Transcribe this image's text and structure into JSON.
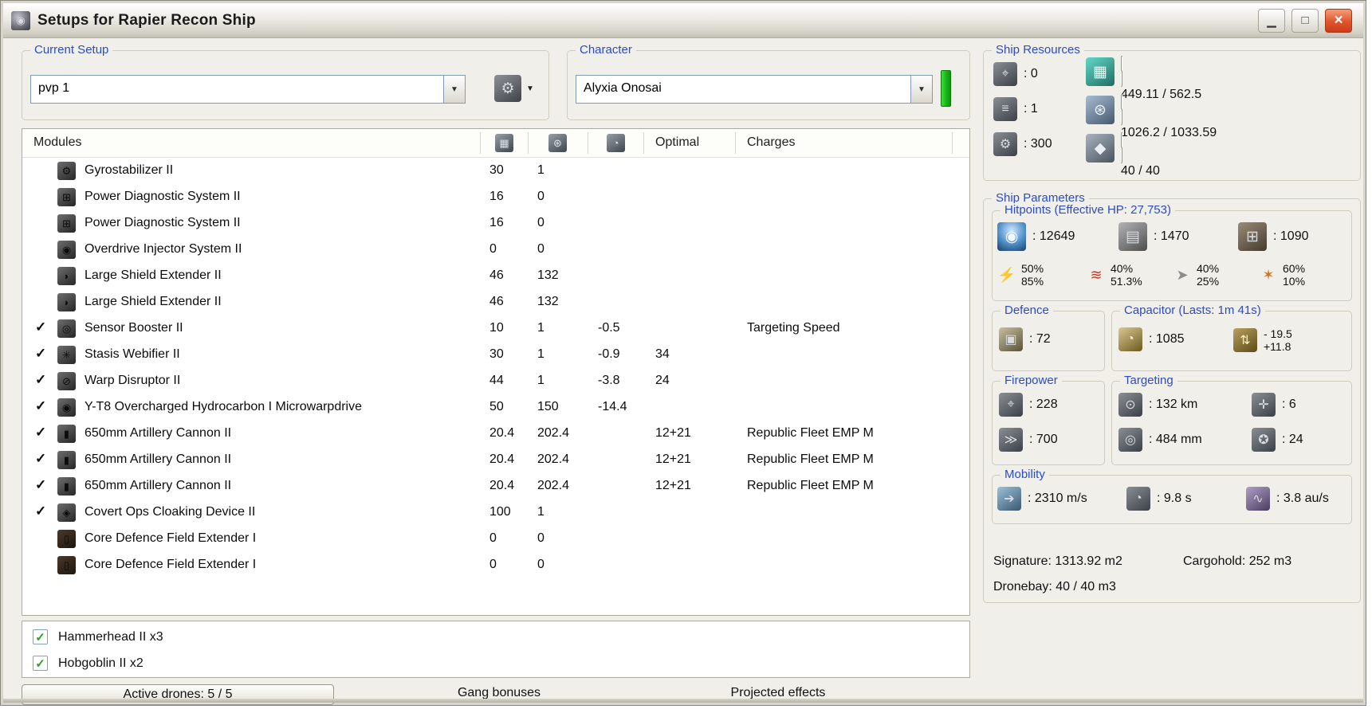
{
  "window": {
    "title": "Setups for Rapier Recon Ship"
  },
  "current_setup": {
    "label": "Current Setup",
    "value": "pvp 1"
  },
  "character": {
    "label": "Character",
    "value": "Alyxia Onosai"
  },
  "ship_resources": {
    "label": "Ship Resources",
    "turrets": ": 0",
    "launchers": ": 1",
    "calibration": ": 300",
    "cpu": "449.11 / 562.5",
    "powergrid": "1026.2 / 1033.59",
    "drones": "40 / 40",
    "cpu_fill_pct": 80,
    "powergrid_fill_pct": 99,
    "drones_fill_pct": 100
  },
  "modules_table": {
    "header": {
      "modules": "Modules",
      "optimal": "Optimal",
      "charges": "Charges"
    },
    "rows": [
      {
        "active": false,
        "icon": "gyrostabilizer-icon",
        "name": "Gyrostabilizer II",
        "cpu": "30",
        "pg": "1",
        "cap": "",
        "optimal": "",
        "charges": ""
      },
      {
        "active": false,
        "icon": "power-diagnostic-icon",
        "name": "Power Diagnostic System II",
        "cpu": "16",
        "pg": "0",
        "cap": "",
        "optimal": "",
        "charges": ""
      },
      {
        "active": false,
        "icon": "power-diagnostic-icon",
        "name": "Power Diagnostic System II",
        "cpu": "16",
        "pg": "0",
        "cap": "",
        "optimal": "",
        "charges": ""
      },
      {
        "active": false,
        "icon": "overdrive-icon",
        "name": "Overdrive Injector System II",
        "cpu": "0",
        "pg": "0",
        "cap": "",
        "optimal": "",
        "charges": ""
      },
      {
        "active": false,
        "icon": "shield-extender-icon",
        "name": "Large Shield Extender II",
        "cpu": "46",
        "pg": "132",
        "cap": "",
        "optimal": "",
        "charges": ""
      },
      {
        "active": false,
        "icon": "shield-extender-icon",
        "name": "Large Shield Extender II",
        "cpu": "46",
        "pg": "132",
        "cap": "",
        "optimal": "",
        "charges": ""
      },
      {
        "active": true,
        "icon": "sensor-booster-icon",
        "name": "Sensor Booster II",
        "cpu": "10",
        "pg": "1",
        "cap": "-0.5",
        "optimal": "",
        "charges": "Targeting Speed"
      },
      {
        "active": true,
        "icon": "stasis-webifier-icon",
        "name": "Stasis Webifier II",
        "cpu": "30",
        "pg": "1",
        "cap": "-0.9",
        "optimal": "34",
        "charges": ""
      },
      {
        "active": true,
        "icon": "warp-disruptor-icon",
        "name": "Warp Disruptor II",
        "cpu": "44",
        "pg": "1",
        "cap": "-3.8",
        "optimal": "24",
        "charges": ""
      },
      {
        "active": true,
        "icon": "microwarpdrive-icon",
        "name": "Y-T8 Overcharged Hydrocarbon I Microwarpdrive",
        "cpu": "50",
        "pg": "150",
        "cap": "-14.4",
        "optimal": "",
        "charges": ""
      },
      {
        "active": true,
        "icon": "artillery-icon",
        "name": "650mm Artillery Cannon II",
        "cpu": "20.4",
        "pg": "202.4",
        "cap": "",
        "optimal": "12+21",
        "charges": "Republic Fleet EMP M"
      },
      {
        "active": true,
        "icon": "artillery-icon",
        "name": "650mm Artillery Cannon II",
        "cpu": "20.4",
        "pg": "202.4",
        "cap": "",
        "optimal": "12+21",
        "charges": "Republic Fleet EMP M"
      },
      {
        "active": true,
        "icon": "artillery-icon",
        "name": "650mm Artillery Cannon II",
        "cpu": "20.4",
        "pg": "202.4",
        "cap": "",
        "optimal": "12+21",
        "charges": "Republic Fleet EMP M"
      },
      {
        "active": true,
        "icon": "cloak-icon",
        "name": "Covert Ops Cloaking Device II",
        "cpu": "100",
        "pg": "1",
        "cap": "",
        "optimal": "",
        "charges": ""
      },
      {
        "active": false,
        "icon": "rig-icon",
        "name": "Core Defence Field Extender I",
        "cpu": "0",
        "pg": "0",
        "cap": "",
        "optimal": "",
        "charges": ""
      },
      {
        "active": false,
        "icon": "rig-icon",
        "name": "Core Defence Field Extender I",
        "cpu": "0",
        "pg": "0",
        "cap": "",
        "optimal": "",
        "charges": ""
      }
    ]
  },
  "drones": {
    "items": [
      {
        "checked": true,
        "label": "Hammerhead II x3"
      },
      {
        "checked": true,
        "label": "Hobgoblin II x2"
      }
    ]
  },
  "footer": {
    "active_drones": "Active drones: 5 / 5",
    "gang_bonuses": "Gang bonuses",
    "projected_effects": "Projected effects"
  },
  "ship_parameters": {
    "label": "Ship Parameters",
    "hitpoints": {
      "label": "Hitpoints (Effective HP: 27,753)",
      "shield": ": 12649",
      "armor": ": 1470",
      "structure": ": 1090",
      "resists": [
        {
          "type": "em",
          "top": "50%",
          "bottom": "85%"
        },
        {
          "type": "thermal",
          "top": "40%",
          "bottom": "51.3%"
        },
        {
          "type": "kinetic",
          "top": "40%",
          "bottom": "25%"
        },
        {
          "type": "explosive",
          "top": "60%",
          "bottom": "10%"
        }
      ]
    },
    "defence": {
      "label": "Defence",
      "value": ": 72"
    },
    "capacitor": {
      "label": "Capacitor (Lasts: 1m 41s)",
      "amount": ": 1085",
      "drain": "- 19.5",
      "recharge": "+11.8"
    },
    "firepower": {
      "label": "Firepower",
      "dps": ": 228",
      "volley": ": 700"
    },
    "targeting": {
      "label": "Targeting",
      "range": ": 132 km",
      "max_targets": ": 6",
      "scan_resolution": ": 484 mm",
      "sensor_strength": ": 24"
    },
    "mobility": {
      "label": "Mobility",
      "speed": ": 2310 m/s",
      "align_time": ": 9.8 s",
      "warp_speed": ": 3.8 au/s"
    },
    "signature": "Signature: 1313.92 m2",
    "cargohold": "Cargohold: 252 m3",
    "dronebay": "Dronebay: 40 / 40 m3"
  },
  "accent_colors": {
    "group_label_blue": "#2c4cc4",
    "active_check_green": "#2fae2f",
    "resource_bar_green": "#34c034",
    "close_button_red": "#d84a22"
  },
  "icons": {
    "window-icon": "◉",
    "minimize-icon": "▁",
    "maximize-icon": "□",
    "close-icon": "×",
    "dropdown-icon": "▼",
    "setup-tool-icon": "⚙",
    "check-icon": "✓",
    "turret-icon": "⌖",
    "launcher-icon": "≡",
    "calibration-icon": "⚙",
    "cpu-icon": "▦",
    "powergrid-icon": "⊛",
    "dronebay-icon": "◆",
    "shield-hp-icon": "◉",
    "armor-hp-icon": "▤",
    "structure-hp-icon": "⊞",
    "em-resist-icon": "⚡",
    "thermal-resist-icon": "≋",
    "kinetic-resist-icon": "➤",
    "explosive-resist-icon": "✶",
    "defence-icon": "▣",
    "capacitor-icon": "◔",
    "cap-flux-icon": "⇅",
    "dps-icon": "⌖",
    "volley-icon": "≫",
    "range-icon": "⊙",
    "max-targets-icon": "✛",
    "scan-res-icon": "◎",
    "sensor-strength-icon": "✪",
    "speed-icon": "➔",
    "align-icon": "◔",
    "warp-icon": "∿",
    "gyrostabilizer-icon": "⚙",
    "power-diagnostic-icon": "⊞",
    "overdrive-icon": "◉",
    "shield-extender-icon": "◗",
    "sensor-booster-icon": "◎",
    "stasis-webifier-icon": "✳",
    "warp-disruptor-icon": "⊘",
    "microwarpdrive-icon": "◉",
    "artillery-icon": "▮",
    "cloak-icon": "◈",
    "rig-icon": "▯"
  }
}
